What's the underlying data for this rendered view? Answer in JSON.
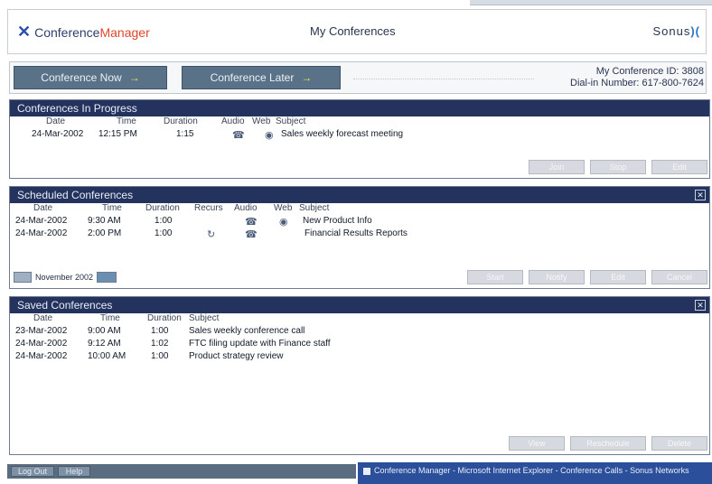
{
  "header": {
    "logo_part1": "Conference",
    "logo_part2": "Manager",
    "title": "My Conferences",
    "brand": "Sonus"
  },
  "toolbar": {
    "conference_now": "Conference Now",
    "conference_later": "Conference Later",
    "conference_id": "My Conference ID: 3808",
    "dial_in": "Dial-in Number: 617-800-7624"
  },
  "in_progress": {
    "title": "Conferences In Progress",
    "columns": [
      "Date",
      "Time",
      "Duration",
      "Audio",
      "Web",
      "Subject"
    ],
    "rows": [
      {
        "date": "24-Mar-2002",
        "time": "12:15 PM",
        "duration": "1:15",
        "subject": "Sales weekly forecast meeting"
      }
    ],
    "buttons": [
      "Join",
      "Stop",
      "Edit"
    ]
  },
  "scheduled": {
    "title": "Scheduled Conferences",
    "columns": [
      "Date",
      "Time",
      "Duration",
      "Recurs",
      "Audio",
      "Web",
      "Subject"
    ],
    "rows": [
      {
        "date": "24-Mar-2002",
        "time": "9:30 AM",
        "duration": "1:00",
        "subject": "New Product Info"
      },
      {
        "date": "24-Mar-2002",
        "time": "2:00 PM",
        "duration": "1:00",
        "subject": "Financial Results Reports"
      }
    ],
    "pager_label": "November 2002",
    "buttons": [
      "Start",
      "Notify",
      "Edit",
      "Cancel"
    ]
  },
  "saved": {
    "title": "Saved Conferences",
    "columns": [
      "Date",
      "Time",
      "Duration",
      "Subject"
    ],
    "rows": [
      {
        "date": "23-Mar-2002",
        "time": "9:00 AM",
        "duration": "1:00",
        "subject": "Sales weekly conference call"
      },
      {
        "date": "24-Mar-2002",
        "time": "9:12 AM",
        "duration": "1:02",
        "subject": "FTC filing update with Finance staff"
      },
      {
        "date": "24-Mar-2002",
        "time": "10:00 AM",
        "duration": "1:00",
        "subject": "Product strategy review"
      }
    ],
    "buttons": [
      "View",
      "Reschedule",
      "Delete"
    ]
  },
  "status": {
    "logout": "Log Out",
    "help": "Help"
  },
  "taskbar": {
    "text": "Conference Manager - Microsoft Internet Explorer - Conference Calls - Sonus Networks"
  }
}
